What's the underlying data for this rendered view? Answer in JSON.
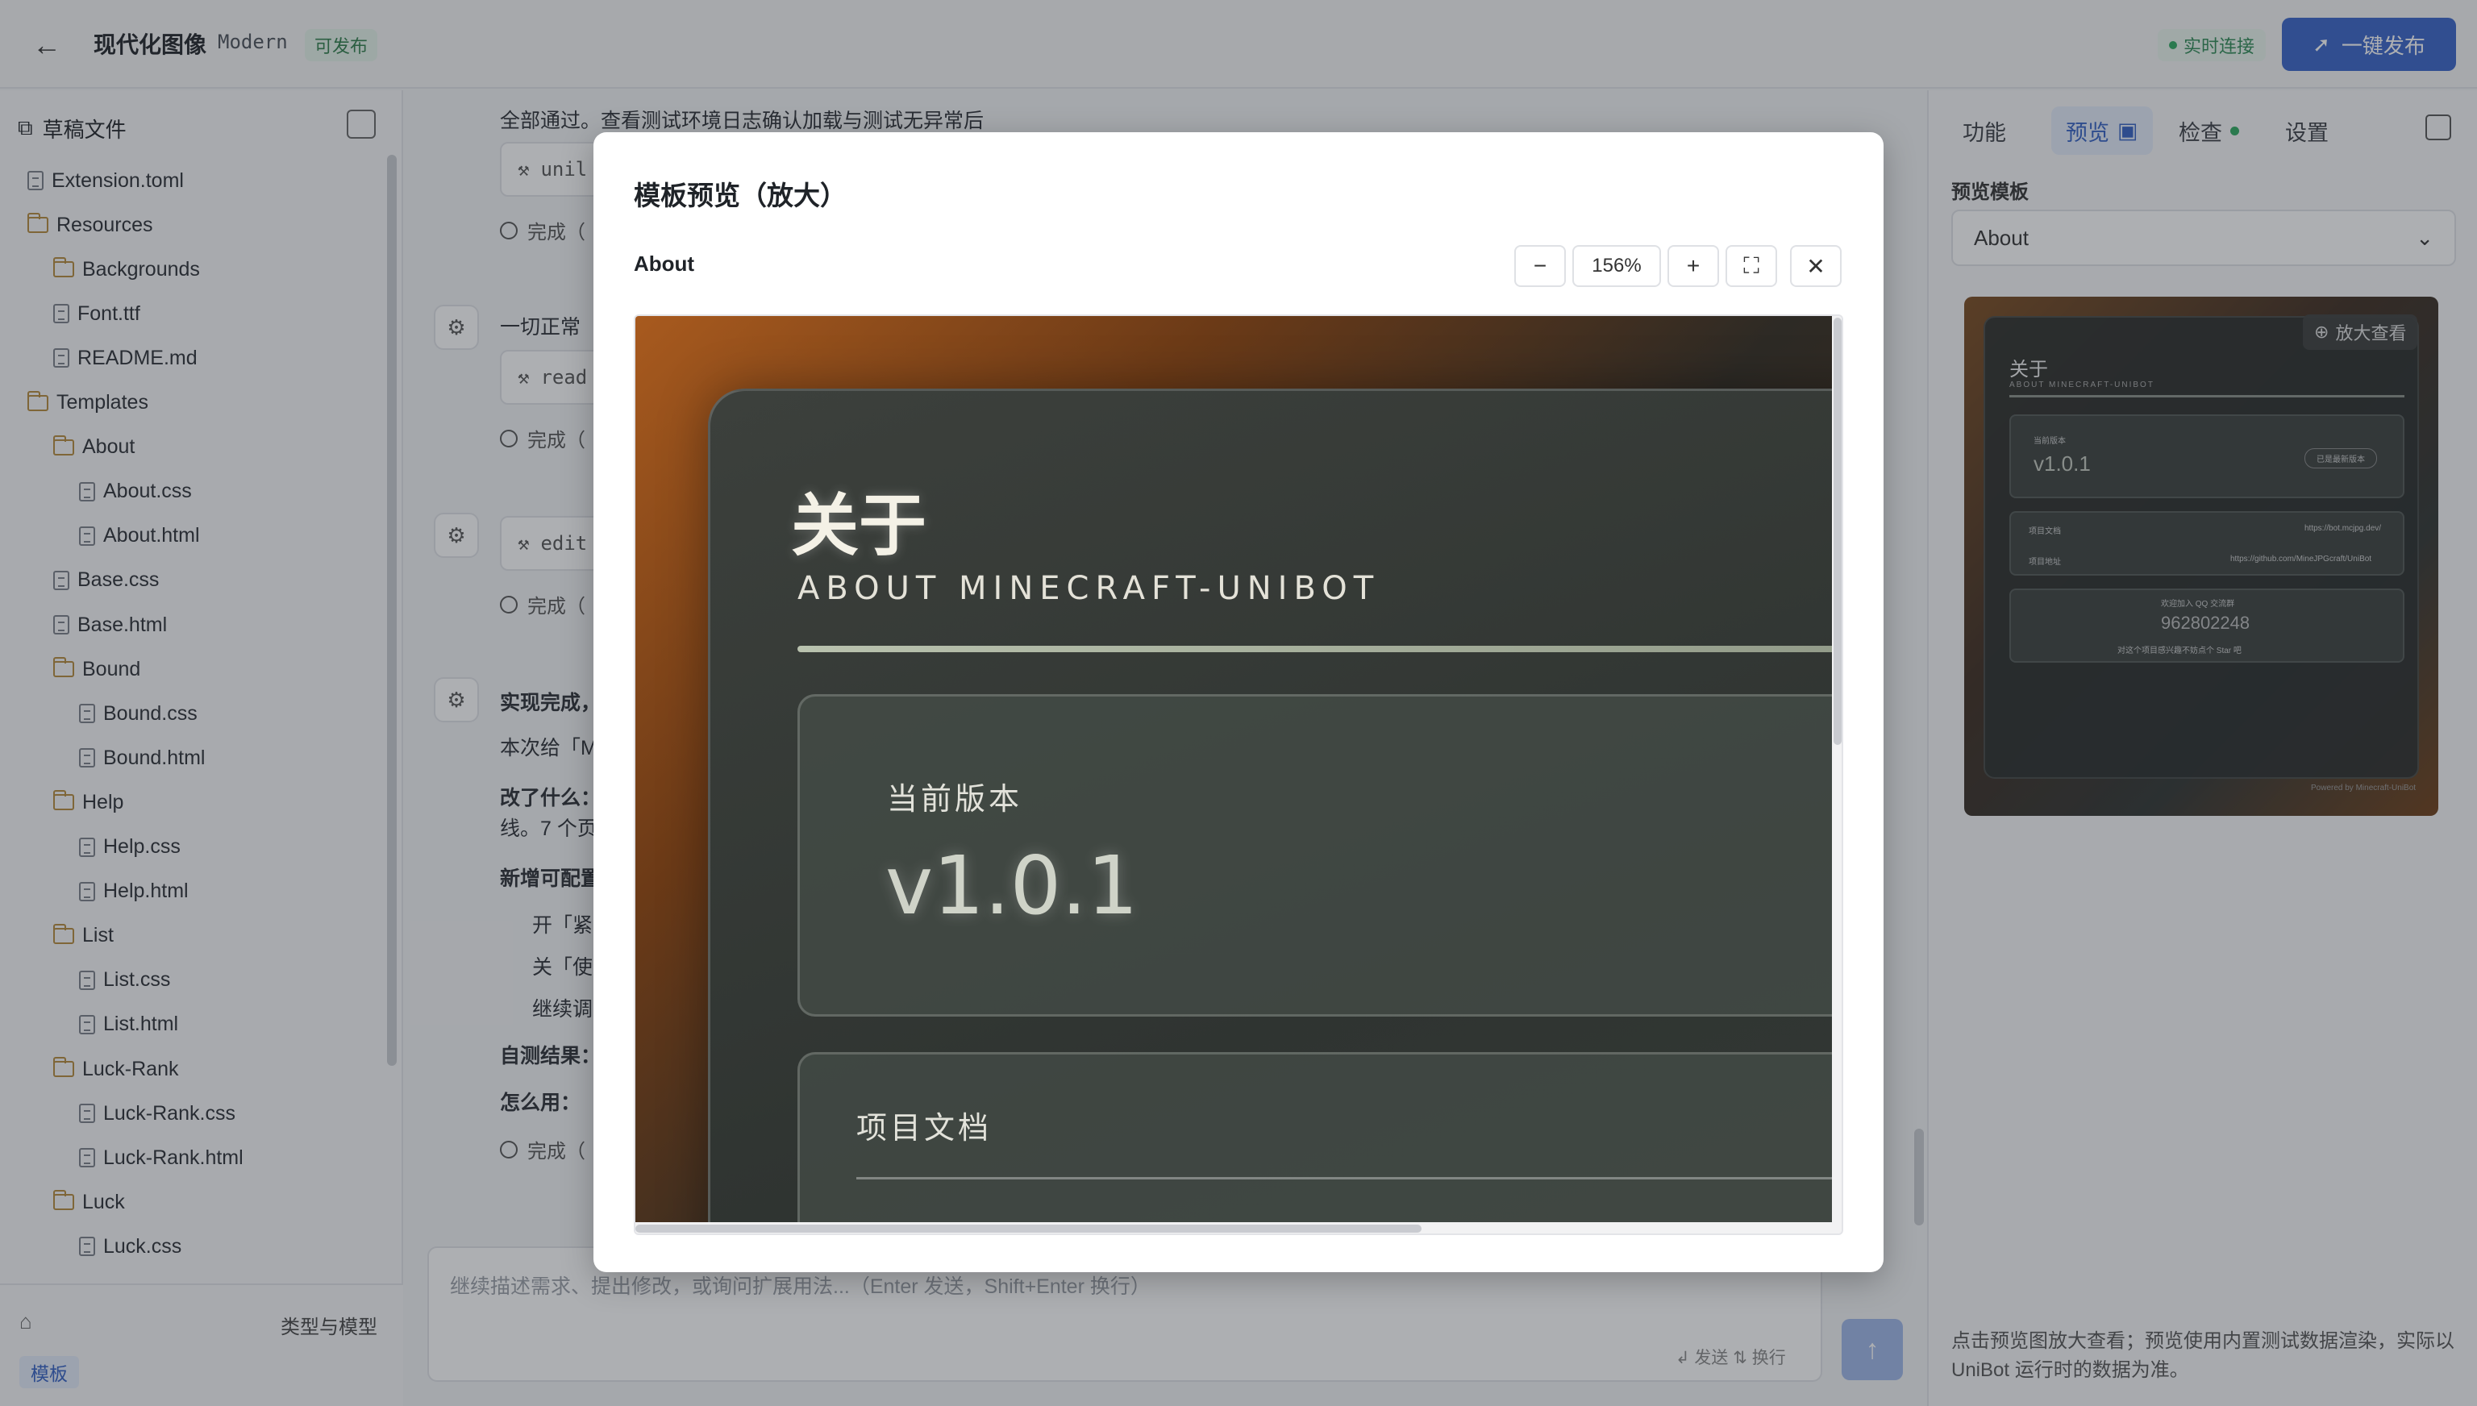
{
  "header": {
    "title": "现代化图像",
    "subtitle": "Modern",
    "status_badge": "可发布",
    "connection": "实时连接",
    "publish_label": "一键发布"
  },
  "sidebar": {
    "title": "草稿文件",
    "tree": [
      {
        "label": "Extension.toml",
        "type": "file",
        "depth": 0
      },
      {
        "label": "Resources",
        "type": "folder",
        "depth": 0
      },
      {
        "label": "Backgrounds",
        "type": "folder",
        "depth": 1
      },
      {
        "label": "Font.ttf",
        "type": "file",
        "depth": 1
      },
      {
        "label": "README.md",
        "type": "file",
        "depth": 1
      },
      {
        "label": "Templates",
        "type": "folder",
        "depth": 0
      },
      {
        "label": "About",
        "type": "folder",
        "depth": 1
      },
      {
        "label": "About.css",
        "type": "file",
        "depth": 2
      },
      {
        "label": "About.html",
        "type": "file",
        "depth": 2
      },
      {
        "label": "Base.css",
        "type": "file",
        "depth": 1
      },
      {
        "label": "Base.html",
        "type": "file",
        "depth": 1
      },
      {
        "label": "Bound",
        "type": "folder",
        "depth": 1
      },
      {
        "label": "Bound.css",
        "type": "file",
        "depth": 2
      },
      {
        "label": "Bound.html",
        "type": "file",
        "depth": 2
      },
      {
        "label": "Help",
        "type": "folder",
        "depth": 1
      },
      {
        "label": "Help.css",
        "type": "file",
        "depth": 2
      },
      {
        "label": "Help.html",
        "type": "file",
        "depth": 2
      },
      {
        "label": "List",
        "type": "folder",
        "depth": 1
      },
      {
        "label": "List.css",
        "type": "file",
        "depth": 2
      },
      {
        "label": "List.html",
        "type": "file",
        "depth": 2
      },
      {
        "label": "Luck-Rank",
        "type": "folder",
        "depth": 1
      },
      {
        "label": "Luck-Rank.css",
        "type": "file",
        "depth": 2
      },
      {
        "label": "Luck-Rank.html",
        "type": "file",
        "depth": 2
      },
      {
        "label": "Luck",
        "type": "folder",
        "depth": 1
      },
      {
        "label": "Luck.css",
        "type": "file",
        "depth": 2
      }
    ],
    "footer_label": "类型与模型",
    "chip": "模板"
  },
  "chat": {
    "line1": "全部通过。查看测试环境日志确认加载与测试无异常后",
    "tool1": "unil",
    "done1": "完成（",
    "msg2": "一切正常",
    "tool2": "read",
    "done2": "完成（",
    "tool3": "edit",
    "done3": "完成（",
    "msg4_title": "实现完成，",
    "msg4_line1": "本次给「M",
    "msg4_changed": "改了什么：",
    "msg4_line2": "线。7 个页",
    "msg4_new": "新增可配置",
    "msg4_b1": "开「紧",
    "msg4_b2": "关「使",
    "msg4_b3": "继续调",
    "msg4_test": "自测结果：",
    "msg4_howto": "怎么用：",
    "done4": "完成（",
    "input_placeholder": "继续描述需求、提出修改，或询问扩展用法...（Enter 发送，Shift+Enter 换行）",
    "input_hint": "↲ 发送  ⇅ 换行"
  },
  "right_panel": {
    "tabs": [
      "功能",
      "预览",
      "检查",
      "设置"
    ],
    "preview_label": "预览模板",
    "select_value": "About",
    "zoom_view": "放大查看",
    "thumb": {
      "title": "关于",
      "subtitle": "ABOUT MINECRAFT-UNIBOT",
      "ver_label": "当前版本",
      "version": "v1.0.1",
      "badge": "已是最新版本",
      "doc_label": "项目文档",
      "doc_url": "https://bot.mcjpg.dev/",
      "repo_label": "项目地址",
      "repo_url": "https://github.com/MineJPGcraft/UniBot",
      "qq_label": "欢迎加入 QQ 交流群",
      "qq_number": "962802248",
      "qq_note": "对这个项目感兴趣不妨点个 Star 吧",
      "powered": "Powered by Minecraft-UniBot"
    },
    "note": "点击预览图放大查看；预览使用内置测试数据渲染，实际以 UniBot 运行时的数据为准。"
  },
  "modal": {
    "title": "模板预览（放大）",
    "template_name": "About",
    "zoom": "156%",
    "preview": {
      "title": "关于",
      "subtitle": "ABOUT MINECRAFT-UNIBOT",
      "ver_label": "当前版本",
      "version": "v1.0.1",
      "doc_label": "项目文档"
    }
  }
}
